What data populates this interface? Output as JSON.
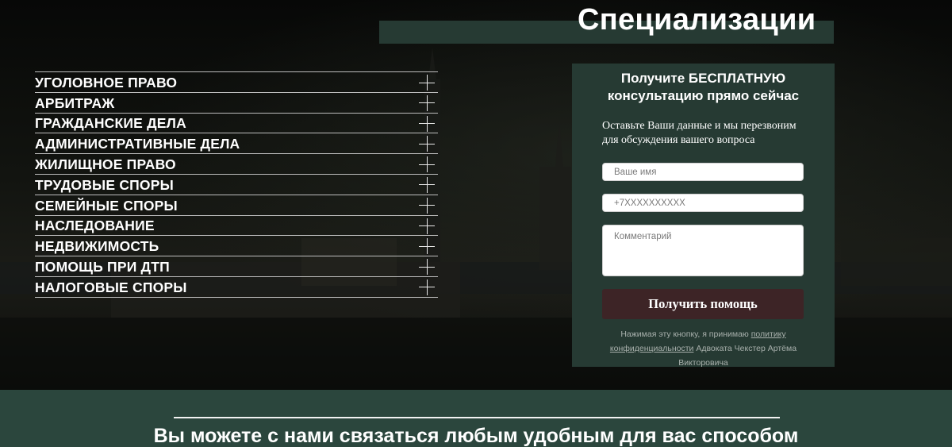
{
  "page": {
    "title": "Специализации"
  },
  "specializations": [
    {
      "label": "УГОЛОВНОЕ ПРАВО",
      "icon": "plus-icon"
    },
    {
      "label": "АРБИТРАЖ",
      "icon": "plus-icon"
    },
    {
      "label": "ГРАЖДАНСКИЕ ДЕЛА",
      "icon": "plus-icon"
    },
    {
      "label": "АДМИНИСТРАТИВНЫЕ ДЕЛА",
      "icon": "plus-icon"
    },
    {
      "label": "ЖИЛИЩНОЕ ПРАВО",
      "icon": "plus-icon"
    },
    {
      "label": "ТРУДОВЫЕ СПОРЫ",
      "icon": "plus-icon"
    },
    {
      "label": "СЕМЕЙНЫЕ СПОРЫ",
      "icon": "plus-icon"
    },
    {
      "label": "НАСЛЕДОВАНИЕ",
      "icon": "plus-icon"
    },
    {
      "label": "НЕДВИЖИМОСТЬ",
      "icon": "plus-icon"
    },
    {
      "label": "ПОМОЩЬ ПРИ ДТП",
      "icon": "plus-icon"
    },
    {
      "label": "НАЛОГОВЫЕ СПОРЫ",
      "icon": "plus-icon"
    }
  ],
  "form": {
    "heading_line1": "Получите БЕСПЛАТНУЮ",
    "heading_line2": "консультацию прямо сейчас",
    "description": "Оставьте Ваши данные и мы перезвоним для обсуждения вашего вопроса",
    "name_placeholder": "Ваше имя",
    "phone_placeholder": "+7XXXXXXXXXX",
    "comment_placeholder": "Комментарий",
    "submit_label": "Получить помощь",
    "consent_prefix": "Нажимая эту кнопку, я принимаю ",
    "consent_link": "политику конфиденциальности",
    "consent_suffix": " Адвоката Чекстер Артёма Викторовича"
  },
  "contact": {
    "title": "Вы можете с нами связаться любым удобным для вас способом"
  },
  "colors": {
    "accent_green": "#263a33",
    "section_green": "#2b463d",
    "button_burgundy": "#3d2426"
  }
}
